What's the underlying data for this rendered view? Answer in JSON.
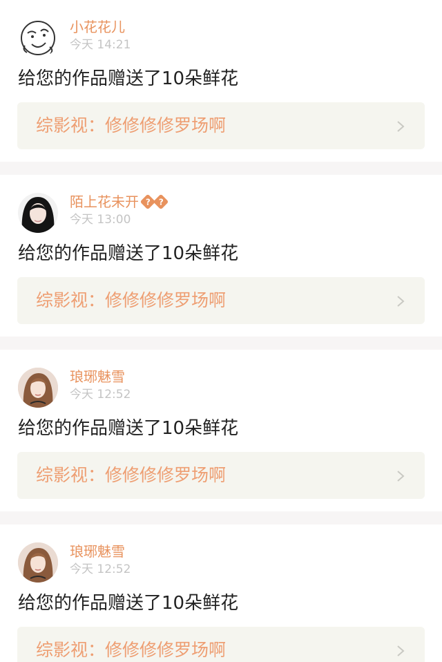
{
  "notifications": [
    {
      "username": "小花花儿",
      "badges": [],
      "time": "今天 14:21",
      "message": "给您的作品赠送了10朵鲜花",
      "work_prefix": "综影视：",
      "work_title": "修修修修罗场啊",
      "avatar": "sketch-face-avatar"
    },
    {
      "username": "陌上花未开",
      "badges": [
        "?",
        "?"
      ],
      "time": "今天 13:00",
      "message": "给您的作品赠送了10朵鲜花",
      "work_prefix": "综影视：",
      "work_title": "修修修修罗场啊",
      "avatar": "dark-hair-avatar"
    },
    {
      "username": "琅琊魅雪",
      "badges": [],
      "time": "今天 12:52",
      "message": "给您的作品赠送了10朵鲜花",
      "work_prefix": "综影视：",
      "work_title": "修修修修罗场啊",
      "avatar": "warm-portrait-avatar"
    },
    {
      "username": "琅琊魅雪",
      "badges": [],
      "time": "今天 12:52",
      "message": "给您的作品赠送了10朵鲜花",
      "work_prefix": "综影视：",
      "work_title": "修修修修罗场啊",
      "avatar": "warm-portrait-avatar"
    }
  ],
  "colors": {
    "username": "#e8925d",
    "time": "#c4c4c4",
    "work_link_bg": "#f5f5ef",
    "work_title": "#ee9e72",
    "separator": "#f7f5f5"
  }
}
